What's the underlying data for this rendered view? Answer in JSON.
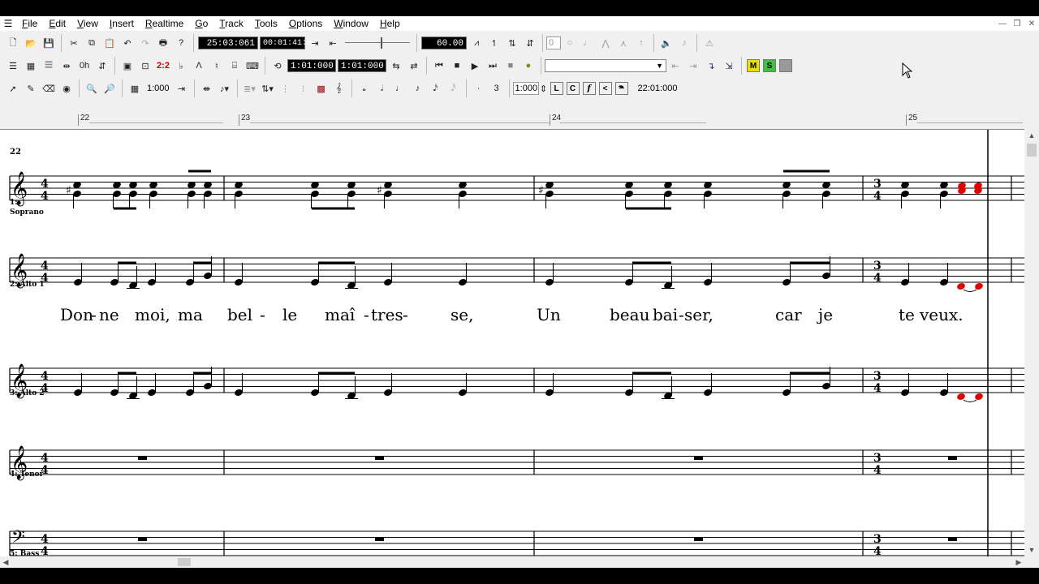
{
  "menu": [
    "File",
    "Edit",
    "View",
    "Insert",
    "Realtime",
    "Go",
    "Track",
    "Tools",
    "Options",
    "Window",
    "Help"
  ],
  "toolbar1": {
    "position_time": "25:03:061",
    "clock_time": "00:01:41:04",
    "tempo": "60.00",
    "counter": "0"
  },
  "toolbar2": {
    "loop_start": "1:01:000",
    "loop_end": "1:01:000",
    "status_m": "M",
    "status_s": "S"
  },
  "toolbar3": {
    "snap_value": "1:000",
    "duration_value": "1:000",
    "position_readout": "22:01:000",
    "articulations": [
      "L",
      "C",
      "f",
      "<"
    ]
  },
  "ruler": {
    "measures": [
      "22",
      "23",
      "24",
      "25"
    ]
  },
  "score": {
    "measure_number": "22",
    "time_signature_first": [
      "4",
      "4"
    ],
    "time_signature_change": [
      "3",
      "4"
    ],
    "staves": [
      {
        "label_num": "1:",
        "label_name": "Soprano"
      },
      {
        "label_num": "2: Alto 1",
        "label_name": ""
      },
      {
        "label_num": "3: Alto 2",
        "label_name": ""
      },
      {
        "label_num": "4: Tenor",
        "label_name": ""
      },
      {
        "label_num": "5: Bass",
        "label_name": ""
      }
    ],
    "lyrics": [
      "Don",
      "-",
      "ne",
      "moi,",
      "ma",
      "bel",
      "-",
      "le",
      "maî",
      "-",
      "tres",
      "-",
      "se,",
      "Un",
      "beau",
      "bai",
      "-",
      "ser,",
      "car",
      "je",
      "te",
      "veux."
    ]
  },
  "colors": {
    "selected_note": "#e00000",
    "lcd_bg": "#000000",
    "chrome": "#f0f0f0"
  }
}
